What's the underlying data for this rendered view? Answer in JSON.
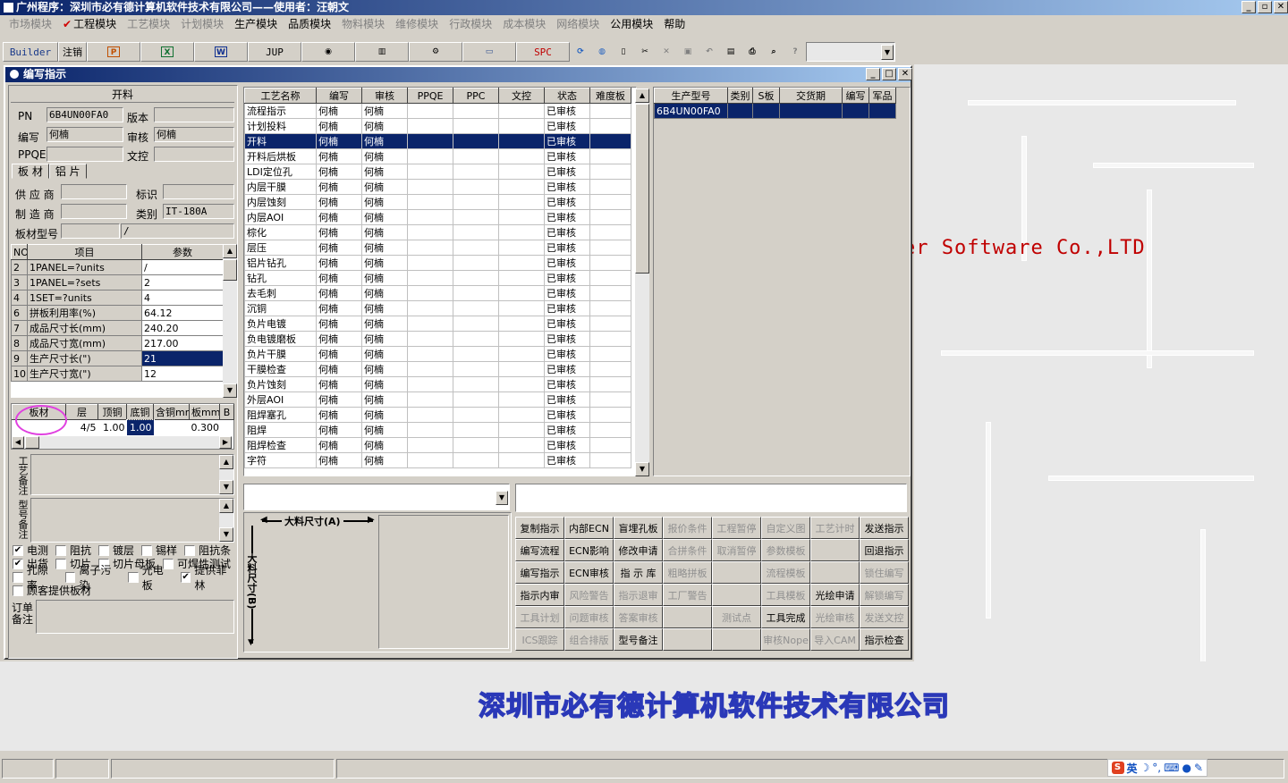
{
  "app": {
    "title": "广州程序：深圳市必有德计算机软件技术有限公司——使用者：汪朝文"
  },
  "menu": [
    {
      "label": "市场模块",
      "enabled": false
    },
    {
      "label": "工程模块",
      "enabled": true,
      "checked": true
    },
    {
      "label": "工艺模块",
      "enabled": false
    },
    {
      "label": "计划模块",
      "enabled": false
    },
    {
      "label": "生产模块",
      "enabled": true
    },
    {
      "label": "品质模块",
      "enabled": true
    },
    {
      "label": "物料模块",
      "enabled": false
    },
    {
      "label": "维修模块",
      "enabled": false
    },
    {
      "label": "行政模块",
      "enabled": false
    },
    {
      "label": "成本模块",
      "enabled": false
    },
    {
      "label": "网络模块",
      "enabled": false
    },
    {
      "label": "公用模块",
      "enabled": true
    },
    {
      "label": "帮助",
      "enabled": true
    }
  ],
  "toolbar": {
    "builder": "Builder",
    "logout": "注销",
    "jup": "JUP",
    "spc": "SPC"
  },
  "child": {
    "title": "编写指示"
  },
  "left": {
    "header": "开料",
    "pn_label": "PN",
    "pn": "6B4UN00FA0",
    "version_label": "版本",
    "version": "",
    "writer_label": "编写",
    "writer": "何楠",
    "review_label": "审核",
    "review": "何楠",
    "ppqe_label": "PPQE",
    "ppqe": "",
    "doc_label": "文控",
    "doc": "",
    "tabs": [
      "板 材",
      "铝 片"
    ],
    "supplier_label": "供 应 商",
    "supplier": "",
    "mark_label": "标识",
    "mark": "",
    "maker_label": "制 造 商",
    "maker": "",
    "type_label": "类别",
    "type": "IT-180A",
    "model_label": "板材型号",
    "model": "",
    "model2": "/",
    "param_headers": [
      "NO",
      "项目",
      "参数"
    ],
    "params": [
      [
        "2",
        "1PANEL=?units",
        "/"
      ],
      [
        "3",
        "1PANEL=?sets",
        "2"
      ],
      [
        "4",
        "1SET=?units",
        "4"
      ],
      [
        "6",
        "拼板利用率(%)",
        "64.12"
      ],
      [
        "7",
        "成品尺寸长(mm)",
        "240.20"
      ],
      [
        "8",
        "成品尺寸宽(mm)",
        "217.00"
      ],
      [
        "9",
        "生产尺寸长(\")",
        "21"
      ],
      [
        "10",
        "生产尺寸宽(\")",
        "12"
      ]
    ],
    "selected_param": 6,
    "layer_headers": [
      "板材",
      "层",
      "顶铜",
      "底铜",
      "含铜mm",
      "板mm",
      "B"
    ],
    "layer_row": [
      "",
      "4/5",
      "1.00",
      "1.00",
      "",
      "0.300",
      ""
    ],
    "process_note_label": "工艺备注",
    "model_note_label": "型号备注",
    "checks": [
      [
        {
          "label": "电测",
          "checked": true
        },
        {
          "label": "阻抗",
          "checked": false
        },
        {
          "label": "镀层",
          "checked": false
        },
        {
          "label": "锡样",
          "checked": false
        },
        {
          "label": "阻抗条",
          "checked": false
        }
      ],
      [
        {
          "label": "出货",
          "checked": true
        },
        {
          "label": "切片",
          "checked": false
        },
        {
          "label": "切片母板",
          "checked": false
        },
        {
          "label": "可焊性测试",
          "checked": false
        }
      ],
      [
        {
          "label": "孔隙率",
          "checked": false
        },
        {
          "label": "离子污染",
          "checked": false
        },
        {
          "label": "光电板",
          "checked": false
        },
        {
          "label": "提供菲林",
          "checked": true
        }
      ],
      [
        {
          "label": "顾客提供板材",
          "checked": false
        }
      ]
    ],
    "order_note_label": "订单备注"
  },
  "process": {
    "headers": [
      "工艺名称",
      "编写",
      "审核",
      "PPQE",
      "PPC",
      "文控",
      "状态",
      "难度板"
    ],
    "rows": [
      [
        "流程指示",
        "何楠",
        "何楠",
        "",
        "",
        "",
        "已审核",
        ""
      ],
      [
        "计划投料",
        "何楠",
        "何楠",
        "",
        "",
        "",
        "已审核",
        ""
      ],
      [
        "开料",
        "何楠",
        "何楠",
        "",
        "",
        "",
        "已审核",
        ""
      ],
      [
        "开料后烘板",
        "何楠",
        "何楠",
        "",
        "",
        "",
        "已审核",
        ""
      ],
      [
        "LDI定位孔",
        "何楠",
        "何楠",
        "",
        "",
        "",
        "已审核",
        ""
      ],
      [
        "内层干膜",
        "何楠",
        "何楠",
        "",
        "",
        "",
        "已审核",
        ""
      ],
      [
        "内层蚀刻",
        "何楠",
        "何楠",
        "",
        "",
        "",
        "已审核",
        ""
      ],
      [
        "内层AOI",
        "何楠",
        "何楠",
        "",
        "",
        "",
        "已审核",
        ""
      ],
      [
        "棕化",
        "何楠",
        "何楠",
        "",
        "",
        "",
        "已审核",
        ""
      ],
      [
        "层压",
        "何楠",
        "何楠",
        "",
        "",
        "",
        "已审核",
        ""
      ],
      [
        "铝片钻孔",
        "何楠",
        "何楠",
        "",
        "",
        "",
        "已审核",
        ""
      ],
      [
        "钻孔",
        "何楠",
        "何楠",
        "",
        "",
        "",
        "已审核",
        ""
      ],
      [
        "去毛刺",
        "何楠",
        "何楠",
        "",
        "",
        "",
        "已审核",
        ""
      ],
      [
        "沉铜",
        "何楠",
        "何楠",
        "",
        "",
        "",
        "已审核",
        ""
      ],
      [
        "负片电镀",
        "何楠",
        "何楠",
        "",
        "",
        "",
        "已审核",
        ""
      ],
      [
        "负电镀磨板",
        "何楠",
        "何楠",
        "",
        "",
        "",
        "已审核",
        ""
      ],
      [
        "负片干膜",
        "何楠",
        "何楠",
        "",
        "",
        "",
        "已审核",
        ""
      ],
      [
        "干膜检查",
        "何楠",
        "何楠",
        "",
        "",
        "",
        "已审核",
        ""
      ],
      [
        "负片蚀刻",
        "何楠",
        "何楠",
        "",
        "",
        "",
        "已审核",
        ""
      ],
      [
        "外层AOI",
        "何楠",
        "何楠",
        "",
        "",
        "",
        "已审核",
        ""
      ],
      [
        "阻焊塞孔",
        "何楠",
        "何楠",
        "",
        "",
        "",
        "已审核",
        ""
      ],
      [
        "阻焊",
        "何楠",
        "何楠",
        "",
        "",
        "",
        "已审核",
        ""
      ],
      [
        "阻焊检查",
        "何楠",
        "何楠",
        "",
        "",
        "",
        "已审核",
        ""
      ],
      [
        "字符",
        "何楠",
        "何楠",
        "",
        "",
        "",
        "已审核",
        ""
      ]
    ],
    "selected": 2
  },
  "model_table": {
    "headers": [
      "生产型号",
      "类别",
      "S板",
      "交货期",
      "编写",
      "军品"
    ],
    "rows": [
      [
        "6B4UN00FA0",
        "",
        "",
        "",
        "",
        ""
      ]
    ]
  },
  "size_labels": {
    "a": "大料尺寸(A)",
    "b": "大料尺寸(B)"
  },
  "buttons": [
    [
      {
        "label": "复制指示",
        "enabled": true
      },
      {
        "label": "内部ECN",
        "enabled": true
      },
      {
        "label": "盲埋孔板",
        "enabled": true
      },
      {
        "label": "报价条件",
        "enabled": false
      },
      {
        "label": "工程暂停",
        "enabled": false
      },
      {
        "label": "自定义图",
        "enabled": false
      },
      {
        "label": "工艺计时",
        "enabled": false
      },
      {
        "label": "发送指示",
        "enabled": true
      }
    ],
    [
      {
        "label": "编写流程",
        "enabled": true
      },
      {
        "label": "ECN影响",
        "enabled": true
      },
      {
        "label": "修改申请",
        "enabled": true
      },
      {
        "label": "合拼条件",
        "enabled": false
      },
      {
        "label": "取消暂停",
        "enabled": false
      },
      {
        "label": "参数模板",
        "enabled": false
      },
      {
        "label": "",
        "enabled": false
      },
      {
        "label": "回退指示",
        "enabled": true
      }
    ],
    [
      {
        "label": "编写指示",
        "enabled": true
      },
      {
        "label": "ECN审核",
        "enabled": true
      },
      {
        "label": "指 示 库",
        "enabled": true
      },
      {
        "label": "粗略拼板",
        "enabled": false
      },
      {
        "label": "",
        "enabled": false
      },
      {
        "label": "流程模板",
        "enabled": false
      },
      {
        "label": "",
        "enabled": false
      },
      {
        "label": "锁住编写",
        "enabled": false
      }
    ],
    [
      {
        "label": "指示内审",
        "enabled": true
      },
      {
        "label": "风险警告",
        "enabled": false
      },
      {
        "label": "指示退审",
        "enabled": false
      },
      {
        "label": "工厂警告",
        "enabled": false
      },
      {
        "label": "",
        "enabled": false
      },
      {
        "label": "工具模板",
        "enabled": false
      },
      {
        "label": "光绘申请",
        "enabled": true
      },
      {
        "label": "解锁编写",
        "enabled": false
      }
    ],
    [
      {
        "label": "工具计划",
        "enabled": false
      },
      {
        "label": "问题审核",
        "enabled": false
      },
      {
        "label": "答案审核",
        "enabled": false
      },
      {
        "label": "",
        "enabled": false
      },
      {
        "label": "测试点",
        "enabled": false
      },
      {
        "label": "工具完成",
        "enabled": true
      },
      {
        "label": "光绘审核",
        "enabled": false
      },
      {
        "label": "发送文控",
        "enabled": false
      }
    ],
    [
      {
        "label": "ICS跟踪",
        "enabled": false
      },
      {
        "label": "组合排版",
        "enabled": false
      },
      {
        "label": "型号备注",
        "enabled": true
      },
      {
        "label": "",
        "enabled": false
      },
      {
        "label": "",
        "enabled": false
      },
      {
        "label": "审核Nope",
        "enabled": false
      },
      {
        "label": "导入CAM",
        "enabled": false
      },
      {
        "label": "指示检查",
        "enabled": true
      }
    ]
  ],
  "desktop": {
    "brand": "er Software Co.,LTD",
    "company": "深圳市必有德计算机软件技术有限公司"
  },
  "ime": {
    "text": "英"
  }
}
